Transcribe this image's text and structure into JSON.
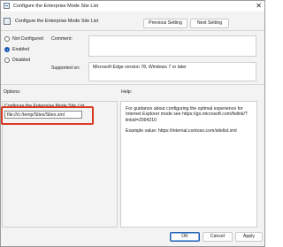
{
  "window": {
    "title": "Configure the Enterprise Mode Site List",
    "close_glyph": "✕"
  },
  "header": {
    "policy_title": "Configure the Enterprise Mode Site List",
    "previous_label": "Previous Setting",
    "next_label": "Next Setting"
  },
  "state": {
    "options": [
      {
        "label": "Not Configured",
        "checked": false
      },
      {
        "label": "Enabled",
        "checked": true
      },
      {
        "label": "Disabled",
        "checked": false
      }
    ]
  },
  "comment": {
    "label": "Comment:",
    "value": ""
  },
  "supported": {
    "label": "Supported on:",
    "value": "Microsoft Edge version 78, Windows 7 or later"
  },
  "options_pane": {
    "heading": "Options:",
    "field_label": "Configure the Enterprise Mode Site List",
    "field_value": "file:///c:/temp/Sites/Sites.xml"
  },
  "help_pane": {
    "heading": "Help:",
    "paragraph1": "For guidance about configuring the optimal experience for Internet Explorer mode see https://go.microsoft.com/fwlink/?linkid=2094210",
    "paragraph2": "Example value: https://internal.contoso.com/sitelist.xml"
  },
  "footer": {
    "ok_label": "OK",
    "cancel_label": "Cancel",
    "apply_label": "Apply"
  },
  "colors": {
    "highlight": "#d83a24",
    "accent": "#1a5fb4"
  }
}
